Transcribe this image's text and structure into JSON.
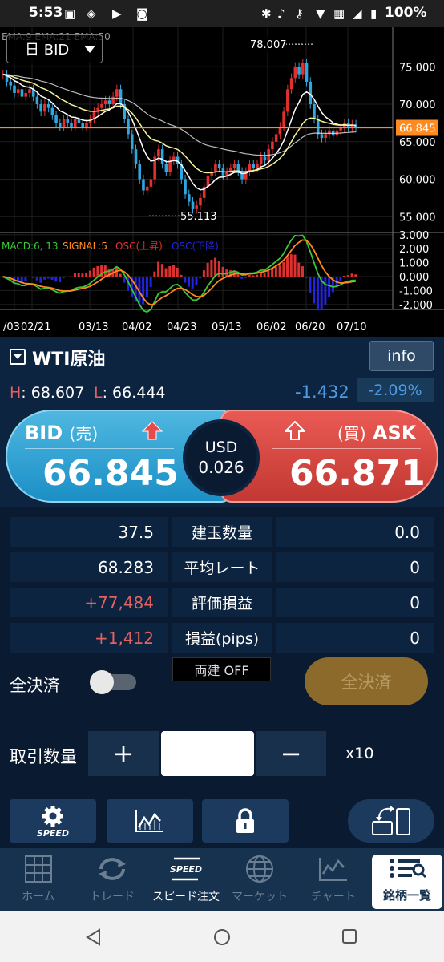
{
  "status_bar": {
    "time": "5:53",
    "battery": "100%"
  },
  "chart": {
    "period_select": "日 BID",
    "ema_legend": "EMA:9  EMA:21  EMA:50",
    "price_axis": [
      "75.000",
      "70.000",
      "65.000",
      "60.000",
      "55.000"
    ],
    "current_price_label": "66.845",
    "high_marker": "78.007",
    "low_marker": "55.113",
    "macd_legend": {
      "macd": "MACD:6, 13",
      "signal": "SIGNAL:5",
      "osc_up": "OSC(上昇)",
      "osc_down": "OSC(下降)"
    },
    "macd_axis": [
      "3.000",
      "2.000",
      "1.000",
      "0.000",
      "-1.000",
      "-2.000"
    ],
    "date_axis": [
      "/03",
      "02/21",
      "03/13",
      "04/02",
      "04/23",
      "05/13",
      "06/02",
      "06/20",
      "07/10"
    ],
    "colors": {
      "bull": "#e03030",
      "bear": "#2fa8e0",
      "current_line": "#ff8a1f",
      "macd_line": "#38c838",
      "signal_line": "#ff8a1f",
      "osc_up": "#e03030",
      "osc_down": "#2323e6"
    }
  },
  "symbol": {
    "name": "WTI原油",
    "info_label": "info"
  },
  "high_low": {
    "h_label": "H",
    "h_value": ": 68.607",
    "l_label": "L",
    "l_value": ": 66.444",
    "change": "-1.432",
    "change_pct": "-2.09%"
  },
  "quote": {
    "bid_label": "BID",
    "bid_sub": "(売)",
    "bid_price": "66.845",
    "ask_label": "ASK",
    "ask_sub": "(買)",
    "ask_price": "66.871",
    "spread_currency": "USD",
    "spread": "0.026"
  },
  "positions": [
    {
      "left": "37.5",
      "label": "建玉数量",
      "right": "0.0"
    },
    {
      "left": "68.283",
      "label": "平均レート",
      "right": "0"
    },
    {
      "left": "+77,484",
      "label": "評価損益",
      "right": "0"
    },
    {
      "left": "+1,412",
      "label": "損益(pips)",
      "right": "0"
    }
  ],
  "hedge": {
    "label": "両建 OFF"
  },
  "settle_all": {
    "label": "全決済",
    "toggle_on": false,
    "button_label": "全決済"
  },
  "quantity": {
    "label": "取引数量",
    "plus": "+",
    "minus": "−",
    "value": "",
    "multiplier": "x10"
  },
  "toolbar": {
    "speed_label": "SPEED"
  },
  "tabs": [
    {
      "label": "ホーム",
      "icon": "home-grid-icon"
    },
    {
      "label": "トレード",
      "icon": "refresh-icon"
    },
    {
      "label": "スピード注文",
      "icon": "speed-icon"
    },
    {
      "label": "マーケット",
      "icon": "globe-icon"
    },
    {
      "label": "チャート",
      "icon": "chart-icon"
    },
    {
      "label": "銘柄一覧",
      "icon": "list-icon"
    }
  ]
}
